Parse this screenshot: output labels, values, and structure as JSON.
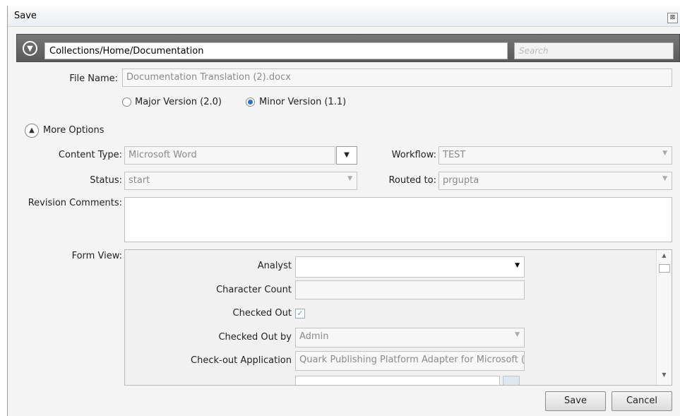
{
  "window": {
    "title": "Save"
  },
  "path": {
    "value": "Collections/Home/Documentation"
  },
  "search": {
    "placeholder": "Search"
  },
  "file": {
    "label": "File Name:",
    "value": "Documentation Translation (2).docx"
  },
  "version": {
    "major_label": "Major Version (2.0)",
    "minor_label": "Minor Version (1.1)",
    "selected": "minor"
  },
  "more_options": {
    "label": "More Options"
  },
  "content_type": {
    "label": "Content Type:",
    "value": "Microsoft Word"
  },
  "workflow": {
    "label": "Workflow:",
    "value": "TEST"
  },
  "status": {
    "label": "Status:",
    "value": "start"
  },
  "routed_to": {
    "label": "Routed to:",
    "value": "prgupta"
  },
  "revision": {
    "label": "Revision Comments:",
    "value": ""
  },
  "form_view": {
    "label": "Form View:",
    "analyst": {
      "label": "Analyst",
      "value": ""
    },
    "char_count": {
      "label": "Character Count",
      "value": ""
    },
    "checked_out": {
      "label": "Checked Out",
      "checked": true
    },
    "checked_out_by": {
      "label": "Checked Out by",
      "value": "Admin"
    },
    "checkout_app": {
      "label": "Check-out Application",
      "value": "Quark Publishing Platform Adapter for Microsoft ("
    }
  },
  "buttons": {
    "save": "Save",
    "cancel": "Cancel"
  },
  "colors": {
    "path_bar": "#666666",
    "accent": "#2a6fc9"
  }
}
